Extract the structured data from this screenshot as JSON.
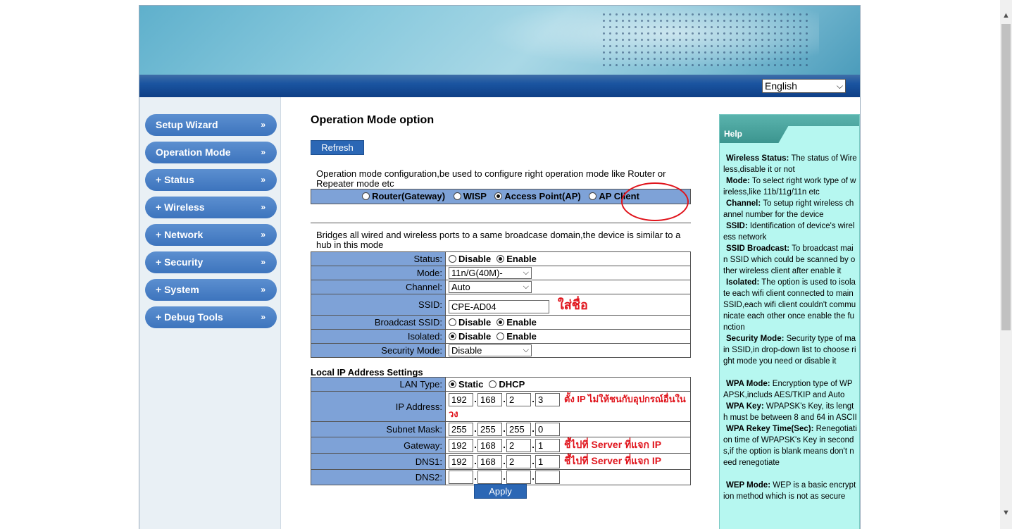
{
  "header": {
    "language": "English"
  },
  "sidebar": {
    "items": [
      {
        "label": "Setup Wizard"
      },
      {
        "label": "Operation Mode"
      },
      {
        "label": "+ Status"
      },
      {
        "label": "+ Wireless"
      },
      {
        "label": "+ Network"
      },
      {
        "label": "+ Security"
      },
      {
        "label": "+ System"
      },
      {
        "label": "+ Debug Tools"
      }
    ],
    "arrow": "»"
  },
  "main": {
    "title": "Operation Mode option",
    "refresh": "Refresh",
    "mode_desc": "Operation mode configuration,be used to configure right operation mode like Router or Repeater mode etc",
    "modes": [
      "Router(Gateway)",
      "WISP",
      "Access Point(AP)",
      "AP Client"
    ],
    "selected_mode": "Access Point(AP)",
    "ap_desc": "Bridges all wired and wireless ports to a same broadcase domain,the device is similar to a hub in this mode",
    "wireless": {
      "status_label": "Status:",
      "disable": "Disable",
      "enable": "Enable",
      "mode_label": "Mode:",
      "mode_value": "11n/G(40M)-",
      "channel_label": "Channel:",
      "channel_value": "Auto",
      "ssid_label": "SSID:",
      "ssid_value": "CPE-AD04",
      "ssid_note": "ใส่ชื่อ",
      "broadcast_label": "Broadcast SSID:",
      "isolated_label": "Isolated:",
      "security_label": "Security Mode:",
      "security_value": "Disable"
    },
    "lan": {
      "section_title": "Local IP Address Settings",
      "type_label": "LAN Type:",
      "static": "Static",
      "dhcp": "DHCP",
      "ip_label": "IP Address:",
      "ip": [
        "192",
        "168",
        "2",
        "3"
      ],
      "ip_note": "ตั้ง IP ไม่ให้ชนกับอุปกรณ์อื่นในวง",
      "mask_label": "Subnet Mask:",
      "mask": [
        "255",
        "255",
        "255",
        "0"
      ],
      "gateway_label": "Gateway:",
      "gateway": [
        "192",
        "168",
        "2",
        "1"
      ],
      "gateway_note": "ชี้ไปที่ Server ที่แจก IP",
      "dns1_label": "DNS1:",
      "dns1": [
        "192",
        "168",
        "2",
        "1"
      ],
      "dns1_note": "ชี้ไปที่ Server ที่แจก IP",
      "dns2_label": "DNS2:",
      "dns2": [
        "",
        "",
        "",
        ""
      ]
    },
    "apply": "Apply"
  },
  "help": {
    "tab": "Help",
    "entries": [
      {
        "term": "Wireless Status:",
        "text": " The status of Wireless,disable it or not"
      },
      {
        "term": "Mode:",
        "text": " To select right work type of wireless,like 11b/11g/11n etc"
      },
      {
        "term": "Channel:",
        "text": " To setup right wireless channel number for the device"
      },
      {
        "term": "SSID:",
        "text": " Identification of device's wireless network"
      },
      {
        "term": "SSID Broadcast:",
        "text": " To broadcast main SSID which could be scanned by other wireless client after enable it"
      },
      {
        "term": "Isolated:",
        "text": " The option is used to isolate each wifi client connected to main SSID,each wifi client couldn't communicate each other once enable the function"
      },
      {
        "term": "Security Mode:",
        "text": " Security type of main SSID,in drop-down list to choose right mode you need or disable it"
      },
      {
        "term": "WPA Mode:",
        "text": " Encryption type of WPAPSK,includs AES/TKIP and Auto"
      },
      {
        "term": "WPA Key:",
        "text": " WPAPSK's Key, its length must be between 8 and 64 in ASCII"
      },
      {
        "term": "WPA Rekey Time(Sec):",
        "text": " Renegotiation time of WPAPSK's Key in seconds,if the option is blank means don't need renegotiate"
      },
      {
        "term": "WEP Mode:",
        "text": " WEP is a basic encryption method which is not as secure"
      }
    ]
  },
  "colors": {
    "nav": "#3d74bd",
    "label_cell": "#7ea2d7",
    "help_bg": "#b6f7f0",
    "annotation": "#e0141c"
  }
}
